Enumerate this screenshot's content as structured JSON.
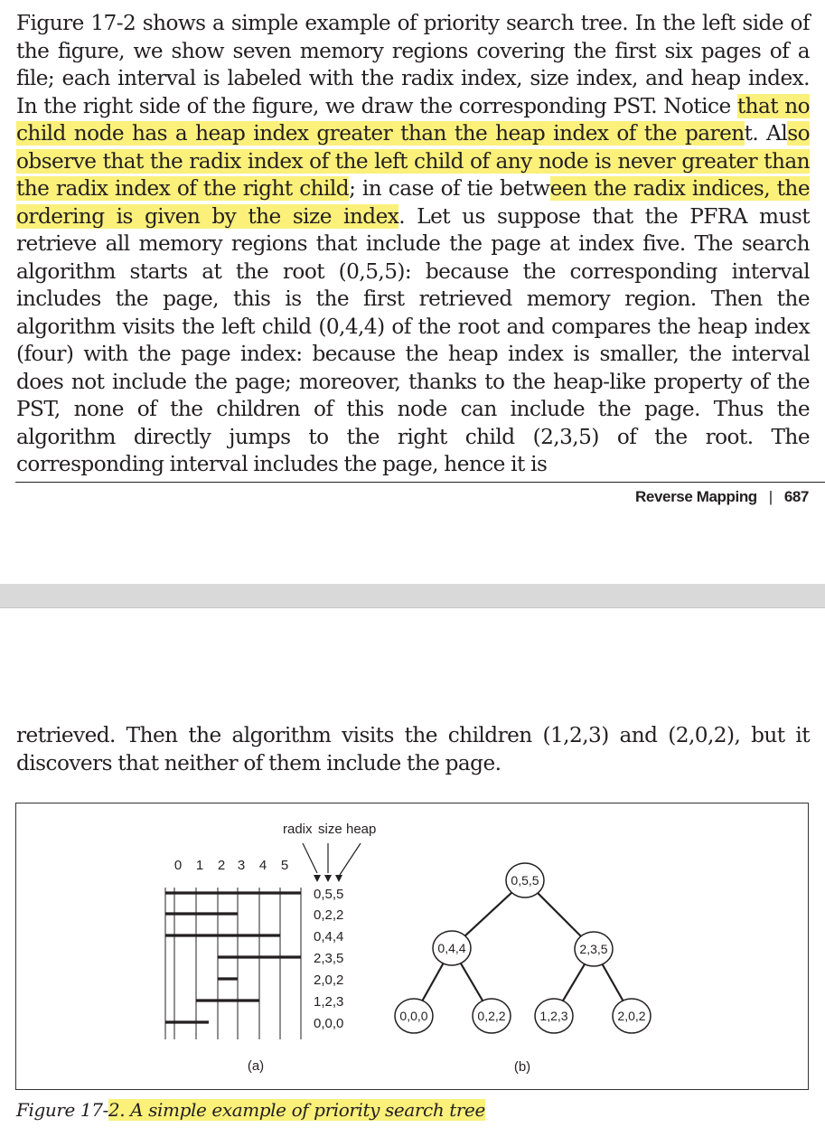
{
  "top_paragraph": {
    "s1": "Figure 17-2 shows a simple example of priority search tree. In the left side of the figure, we show seven memory regions covering the first six pages of a file; each interval is labeled with the radix index, size index, and heap index. In the right side of the figure, we draw the corresponding PST. Notice ",
    "h1": "that no child node has a heap index greater than the heap index of the paren",
    "s2": "t. Al",
    "h2": "so observe that the radix index of the left child of any node is never greater than the radix index of the right child",
    "s3": "; in case of tie betw",
    "h3": "een the radix indices, the ordering is given by the size index",
    "s4": ". Let us suppose that the PFRA must retrieve all memory regions that include the page at index five. The search algorithm starts at the root (0,5,5): because the corresponding interval includes the page, this is the first retrieved memory region. Then the algorithm visits the left child (0,4,4) of the root and compares the heap index (four) with the page index: because the heap index is smaller, the interval does not include the page; moreover, thanks to the heap-like property of the PST, none of the children of this node can include the page. Thus the algorithm directly jumps to the right child (2,3,5) of the root. The corresponding interval includes the page, hence it is"
  },
  "footer": {
    "section": "Reverse Mapping",
    "separator": "|",
    "page_number": "687"
  },
  "bottom_paragraph": {
    "text": "retrieved. Then the algorithm visits the children (1,2,3) and (2,0,2), but it discovers that neither of them include the page."
  },
  "figure": {
    "header_labels": [
      "radix",
      "size",
      "heap"
    ],
    "page_indices": [
      "0",
      "1",
      "2",
      "3",
      "4",
      "5"
    ],
    "interval_labels": [
      "0,5,5",
      "0,2,2",
      "0,4,4",
      "2,3,5",
      "2,0,2",
      "1,2,3",
      "0,0,0"
    ],
    "intervals": [
      {
        "label": "0,5,5",
        "start": 0,
        "end": 5
      },
      {
        "label": "0,2,2",
        "start": 0,
        "end": 2
      },
      {
        "label": "0,4,4",
        "start": 0,
        "end": 4
      },
      {
        "label": "2,3,5",
        "start": 2,
        "end": 5
      },
      {
        "label": "2,0,2",
        "start": 2,
        "end": 2
      },
      {
        "label": "1,2,3",
        "start": 1,
        "end": 3
      },
      {
        "label": "0,0,0",
        "start": 0,
        "end": 0
      }
    ],
    "tree_nodes": [
      {
        "id": "root",
        "label": "0,5,5"
      },
      {
        "id": "n044",
        "label": "0,4,4"
      },
      {
        "id": "n235",
        "label": "2,3,5"
      },
      {
        "id": "n000",
        "label": "0,0,0"
      },
      {
        "id": "n022",
        "label": "0,2,2"
      },
      {
        "id": "n123",
        "label": "1,2,3"
      },
      {
        "id": "n202",
        "label": "2,0,2"
      }
    ],
    "tree_edges": [
      [
        "root",
        "n044"
      ],
      [
        "root",
        "n235"
      ],
      [
        "n044",
        "n000"
      ],
      [
        "n044",
        "n022"
      ],
      [
        "n235",
        "n123"
      ],
      [
        "n235",
        "n202"
      ]
    ],
    "sublabel_a": "(a)",
    "sublabel_b": "(b)"
  },
  "caption": {
    "prefix": "Figure 17-",
    "highlighted": "2. A simple example of priority search tree"
  },
  "colors": {
    "highlight": "#fbf07a",
    "text": "#231f20",
    "page_gap": "#d9d9d9"
  }
}
